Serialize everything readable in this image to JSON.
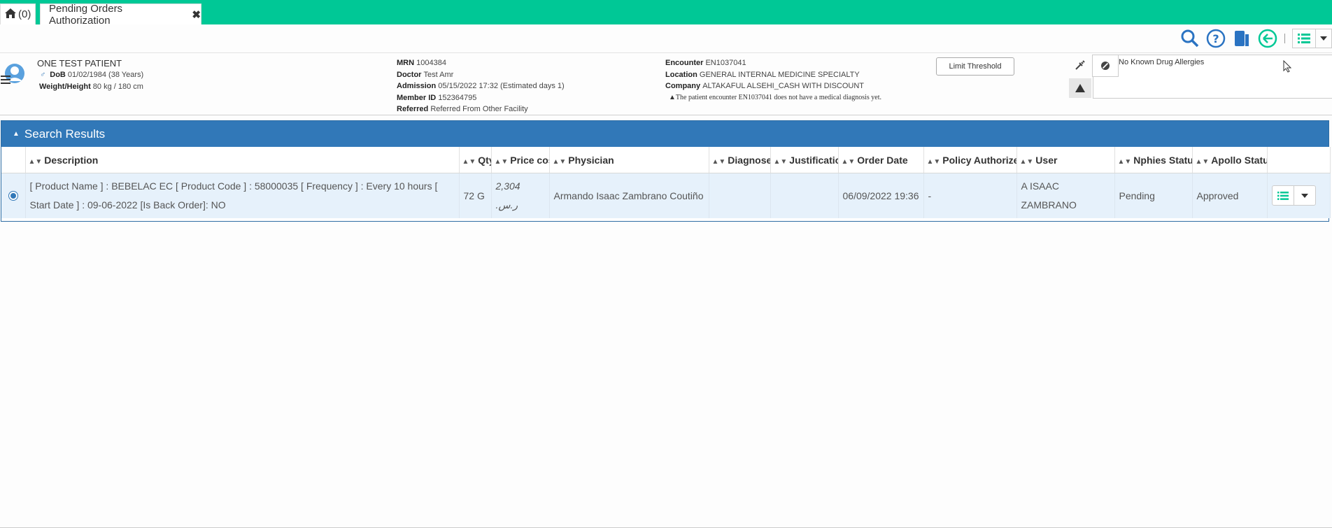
{
  "colors": {
    "accent": "#00c896",
    "panel_header": "#3178b8",
    "row_bg": "#e6f1fb"
  },
  "tabs": {
    "home_count": "(0)",
    "active_label": "Pending Orders Authorization"
  },
  "toolbar": {
    "icons": [
      "search-icon",
      "help-icon",
      "document-icon",
      "back-icon",
      "list-icon",
      "chevron-down-icon"
    ]
  },
  "patient": {
    "name": "ONE TEST PATIENT",
    "gender_symbol": "♂",
    "dob_label": "DoB",
    "dob": "01/02/1984 (38 Years)",
    "wh_label": "Weight/Height",
    "wh": "80 kg / 180 cm",
    "mrn_label": "MRN",
    "mrn": "1004384",
    "doctor_label": "Doctor",
    "doctor": "Test Amr",
    "admission_label": "Admission",
    "admission": "05/15/2022 17:32 (Estimated days 1)",
    "member_label": "Member ID",
    "member": "152364795",
    "referred_label": "Referred",
    "referred": "Referred From Other Facility",
    "encounter_label": "Encounter",
    "encounter": "EN1037041",
    "location_label": "Location",
    "location": "GENERAL INTERNAL MEDICINE SPECIALTY",
    "company_label": "Company",
    "company": "ALTAKAFUL ALSEHI_CASH WITH DISCOUNT",
    "warning": "The patient encounter EN1037041 does not have a medical diagnosis yet.",
    "limit_button": "Limit Threshold",
    "allergies": "No Known Drug Allergies"
  },
  "results": {
    "title": "Search Results",
    "columns": [
      "Description",
      "Qty",
      "Price cost",
      "Physician",
      "Diagnoses",
      "Justification",
      "Order Date",
      "Policy Authorized",
      "User",
      "Nphies Status",
      "Apollo Status"
    ],
    "rows": [
      {
        "description": "[ Product Name ] : BEBELAC EC [ Product Code ] : 58000035 [ Frequency ] : Every 10 hours [ Start Date ] : 09-06-2022 [Is Back Order]: NO",
        "qty": "72 G",
        "price": "2,304 .ر.س",
        "physician": "Armando Isaac Zambrano Coutiño",
        "diagnoses": "",
        "justification": "",
        "order_date": "06/09/2022 19:36",
        "policy": "-",
        "user": "A ISAAC ZAMBRANO",
        "nphies": "Pending",
        "apollo": "Approved"
      }
    ]
  }
}
